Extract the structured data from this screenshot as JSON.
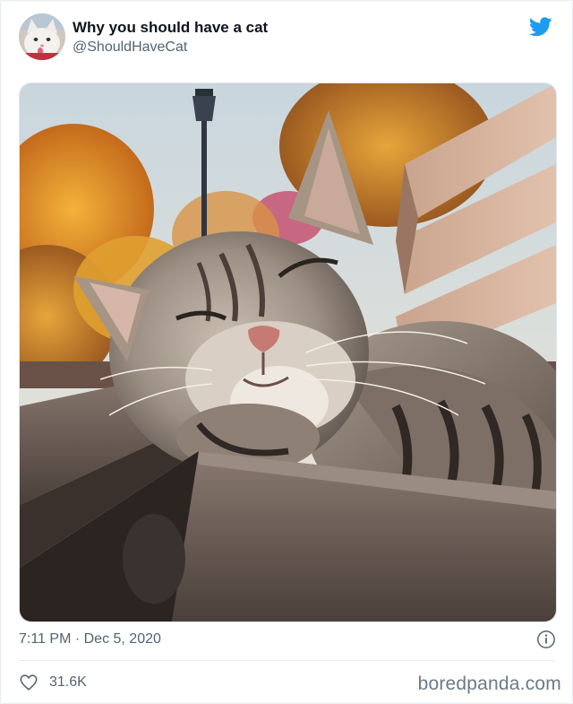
{
  "tweet": {
    "display_name": "Why you should have a cat",
    "handle": "@ShouldHaveCat",
    "timestamp": "7:11 PM · Dec 5, 2020",
    "like_count": "31.6K"
  },
  "icons": {
    "brand": "twitter-bird-icon",
    "info": "info-icon",
    "like": "heart-icon"
  },
  "watermark": "boredpanda.com",
  "colors": {
    "twitter_blue": "#1d9bf0",
    "muted_text": "#536471",
    "text": "#0f1419"
  }
}
